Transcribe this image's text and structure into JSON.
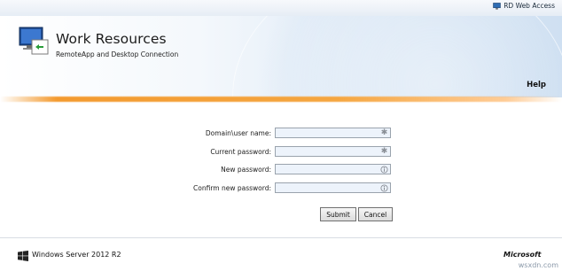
{
  "topbar": {
    "rd_web_access_label": "RD Web Access",
    "icon": "monitor-icon"
  },
  "header": {
    "title": "Work Resources",
    "subtitle": "RemoteApp and Desktop Connection",
    "app_icon": "remote-desktop-icon",
    "help_label": "Help"
  },
  "form": {
    "fields": [
      {
        "label": "Domain\\user name:",
        "value": "",
        "icon": "asterisk-icon"
      },
      {
        "label": "Current password:",
        "value": "",
        "icon": "asterisk-icon"
      },
      {
        "label": "New password:",
        "value": "",
        "icon": "info-circle-icon"
      },
      {
        "label": "Confirm new password:",
        "value": "",
        "icon": "info-circle-icon"
      }
    ],
    "submit_label": "Submit",
    "cancel_label": "Cancel"
  },
  "footer": {
    "product": "Windows Server 2012 R2",
    "brand": "Microsoft",
    "watermark": "wsxdn.com"
  },
  "colors": {
    "accent_orange": "#f39a2f",
    "field_bg": "#edf3fb"
  }
}
